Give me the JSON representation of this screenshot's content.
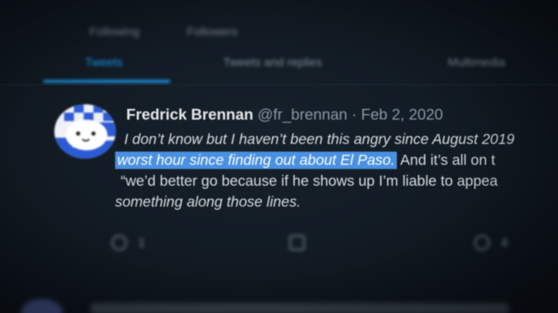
{
  "profile": {
    "stats_line": "",
    "following_count": "",
    "following_label": "Following",
    "followers_count": "",
    "followers_label": "Followers"
  },
  "tabs": [
    {
      "label": "Tweets",
      "active": true
    },
    {
      "label": "Tweets and replies",
      "active": false
    },
    {
      "label": "Multimedia",
      "active": false
    }
  ],
  "tweet": {
    "author_name": "Fredrick Brennan",
    "handle": "@fr_brennan",
    "separator": "·",
    "date": "Feb 2, 2020",
    "line1": "I don’t know but I haven’t been this angry since August 2019",
    "line2_highlight": "worst hour since finding out about El Paso.",
    "line2_rest": " And it’s all on t",
    "line3": "“we’d better go because if he shows up I’m liable to appea",
    "line4": "something along those lines.",
    "highlight_color": "#4a90e2",
    "actions": {
      "reply_icon": "reply-icon",
      "reply_count": "1",
      "retweet_icon": "retweet-icon",
      "retweet_count": "",
      "like_icon": "like-icon",
      "like_count": "4"
    }
  },
  "colors": {
    "accent": "#1d9bf0",
    "background": "#111a23",
    "text_primary": "#e7e9ea",
    "text_secondary": "#8b98a5"
  }
}
